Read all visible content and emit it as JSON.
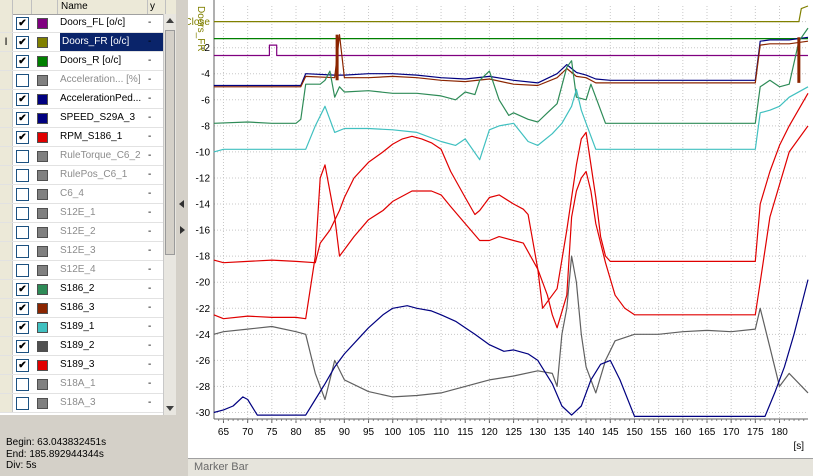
{
  "signal_list": {
    "headers": {
      "name": "Name",
      "y": "y"
    },
    "rows": [
      {
        "checked": true,
        "color": "#800080",
        "name": "Doors_FL [o/c]",
        "y": "-",
        "state": "normal"
      },
      {
        "checked": true,
        "color": "#808000",
        "name": "Doors_FR [o/c]",
        "y": "-",
        "state": "selected"
      },
      {
        "checked": true,
        "color": "#008000",
        "name": "Doors_R [o/c]",
        "y": "-",
        "state": "normal"
      },
      {
        "checked": false,
        "color": "#808080",
        "name": "Acceleration... [%]",
        "y": "-",
        "state": "dim"
      },
      {
        "checked": true,
        "color": "#000080",
        "name": "AccelerationPed...",
        "y": "-",
        "state": "normal"
      },
      {
        "checked": true,
        "color": "#000080",
        "name": "SPEED_S29A_3",
        "y": "-",
        "state": "normal"
      },
      {
        "checked": true,
        "color": "#e00000",
        "name": "RPM_S186_1",
        "y": "-",
        "state": "normal"
      },
      {
        "checked": false,
        "color": "#808080",
        "name": "RuleTorque_C6_2",
        "y": "-",
        "state": "dim"
      },
      {
        "checked": false,
        "color": "#808080",
        "name": "RulePos_C6_1",
        "y": "-",
        "state": "dim"
      },
      {
        "checked": false,
        "color": "#808080",
        "name": "C6_4",
        "y": "-",
        "state": "dim"
      },
      {
        "checked": false,
        "color": "#808080",
        "name": "S12E_1",
        "y": "-",
        "state": "dim"
      },
      {
        "checked": false,
        "color": "#808080",
        "name": "S12E_2",
        "y": "-",
        "state": "dim"
      },
      {
        "checked": false,
        "color": "#808080",
        "name": "S12E_3",
        "y": "-",
        "state": "dim"
      },
      {
        "checked": false,
        "color": "#808080",
        "name": "S12E_4",
        "y": "-",
        "state": "dim"
      },
      {
        "checked": true,
        "color": "#2e8b57",
        "name": "S186_2",
        "y": "-",
        "state": "normal"
      },
      {
        "checked": true,
        "color": "#8b2500",
        "name": "S186_3",
        "y": "-",
        "state": "normal"
      },
      {
        "checked": true,
        "color": "#40c0c0",
        "name": "S189_1",
        "y": "-",
        "state": "normal"
      },
      {
        "checked": true,
        "color": "#505050",
        "name": "S189_2",
        "y": "-",
        "state": "normal"
      },
      {
        "checked": true,
        "color": "#e00000",
        "name": "S189_3",
        "y": "-",
        "state": "normal"
      },
      {
        "checked": false,
        "color": "#808080",
        "name": "S18A_1",
        "y": "-",
        "state": "dim"
      },
      {
        "checked": false,
        "color": "#808080",
        "name": "S18A_3",
        "y": "-",
        "state": "dim"
      }
    ]
  },
  "time_info": {
    "begin": "Begin: 63.043832451s",
    "end": "End: 185.892944344s",
    "div": "Div: 5s"
  },
  "marker_bar": {
    "label": "Marker Bar"
  },
  "chart_data": {
    "type": "line",
    "ylabel": "Doors_FR",
    "xunit": "[s]",
    "xlim": [
      63.04,
      185.89
    ],
    "ylim": [
      -30.5,
      1.2
    ],
    "grid": true,
    "x_ticks": [
      65,
      70,
      75,
      80,
      85,
      90,
      95,
      100,
      105,
      110,
      115,
      120,
      125,
      130,
      135,
      140,
      145,
      150,
      155,
      160,
      165,
      170,
      175,
      180
    ],
    "y_ticks": [
      {
        "v": 0,
        "label": "Close"
      },
      {
        "v": -2,
        "label": "-2"
      },
      {
        "v": -4,
        "label": "-4"
      },
      {
        "v": -6,
        "label": "-6"
      },
      {
        "v": -8,
        "label": "-8"
      },
      {
        "v": -10,
        "label": "-10"
      },
      {
        "v": -12,
        "label": "-12"
      },
      {
        "v": -14,
        "label": "-14"
      },
      {
        "v": -16,
        "label": "-16"
      },
      {
        "v": -18,
        "label": "-18"
      },
      {
        "v": -20,
        "label": "-20"
      },
      {
        "v": -22,
        "label": "-22"
      },
      {
        "v": -24,
        "label": "-24"
      },
      {
        "v": -26,
        "label": "-26"
      },
      {
        "v": -28,
        "label": "-28"
      },
      {
        "v": -30,
        "label": "-30"
      }
    ],
    "series": [
      {
        "color": "#808000",
        "x": [
          63,
          184,
          184.5,
          185.9
        ],
        "y": [
          0,
          0,
          1,
          1.2
        ]
      },
      {
        "color": "#008000",
        "x": [
          63,
          185.9
        ],
        "y": [
          -1.3,
          -1.3
        ]
      },
      {
        "color": "#800080",
        "x": [
          63,
          74.5,
          74.5,
          76,
          76,
          185.9
        ],
        "y": [
          -2.6,
          -2.6,
          -1.8,
          -1.8,
          -2.6,
          -2.6
        ]
      },
      {
        "color": "#000080",
        "x": [
          63,
          81,
          82,
          88,
          90,
          95,
          100,
          105,
          110,
          115,
          120,
          125,
          130,
          134,
          136,
          138,
          140,
          142,
          145,
          150,
          155,
          160,
          165,
          170,
          175,
          176,
          178,
          182,
          185.9
        ],
        "y": [
          -4.9,
          -4.9,
          -4.0,
          -4.1,
          -4.1,
          -4.0,
          -4.0,
          -4.1,
          -4.3,
          -4.4,
          -4.2,
          -4.5,
          -4.7,
          -4.0,
          -3.3,
          -3.9,
          -4.1,
          -4.4,
          -4.5,
          -4.5,
          -4.5,
          -4.5,
          -4.5,
          -4.5,
          -4.5,
          -1.5,
          -1.4,
          -1.4,
          -1.2
        ]
      },
      {
        "color": "#8b2500",
        "x": [
          63,
          81,
          82,
          88,
          89,
          90,
          95,
          100,
          105,
          110,
          115,
          120,
          125,
          130,
          134,
          136,
          138,
          140,
          142,
          145,
          150,
          160,
          170,
          175,
          176,
          178,
          182,
          185.9
        ],
        "y": [
          -5.0,
          -5.0,
          -4.2,
          -4.3,
          -1.0,
          -4.3,
          -4.3,
          -4.2,
          -4.3,
          -4.5,
          -4.6,
          -4.4,
          -4.8,
          -4.9,
          -4.3,
          -3.6,
          -4.2,
          -4.3,
          -4.7,
          -4.7,
          -4.7,
          -4.7,
          -4.7,
          -4.7,
          -1.8,
          -1.7,
          -1.7,
          -1.5
        ]
      },
      {
        "color": "#2e8b57",
        "x": [
          63,
          70,
          75,
          80,
          81,
          82,
          85,
          86,
          87,
          88,
          89,
          90,
          95,
          100,
          105,
          110,
          113,
          115,
          117,
          118,
          120,
          122,
          124,
          125,
          128,
          130,
          132,
          134,
          136,
          137,
          138,
          140,
          141,
          142,
          144,
          145,
          150,
          155,
          160,
          165,
          170,
          175,
          176,
          178,
          180,
          182,
          184,
          185.9
        ],
        "y": [
          -7.8,
          -7.7,
          -7.8,
          -7.8,
          -7.5,
          -4.8,
          -4.8,
          -4.5,
          -3.8,
          -5.8,
          -5.0,
          -5.4,
          -5.3,
          -5.5,
          -5.5,
          -5.7,
          -6.0,
          -5.4,
          -5.6,
          -4.5,
          -3.8,
          -6.0,
          -7.2,
          -7.0,
          -7.5,
          -7.7,
          -7.0,
          -6.3,
          -3.5,
          -3.0,
          -5.8,
          -6.0,
          -4.8,
          -5.8,
          -7.8,
          -7.8,
          -7.8,
          -7.8,
          -7.8,
          -7.8,
          -7.8,
          -7.8,
          -5.0,
          -4.5,
          -5.0,
          -4.8,
          -1.5,
          -0.5
        ]
      },
      {
        "color": "#40c0c0",
        "x": [
          63,
          65,
          70,
          75,
          80,
          82,
          84,
          86,
          88,
          90,
          95,
          100,
          105,
          110,
          113,
          115,
          118,
          120,
          122,
          125,
          128,
          130,
          133,
          135,
          137,
          138,
          139,
          140,
          142,
          145,
          150,
          160,
          170,
          175,
          176,
          178,
          180,
          182,
          185.9
        ],
        "y": [
          -10.0,
          -9.8,
          -9.8,
          -9.8,
          -9.8,
          -9.8,
          -8.0,
          -6.5,
          -8.5,
          -8.2,
          -8.2,
          -8.3,
          -8.5,
          -9.2,
          -9.5,
          -9.0,
          -10.6,
          -8.3,
          -8.0,
          -7.8,
          -9.2,
          -9.5,
          -8.6,
          -7.8,
          -6.5,
          -5.2,
          -6.8,
          -7.8,
          -9.8,
          -9.8,
          -9.8,
          -9.8,
          -9.8,
          -9.8,
          -7.0,
          -6.8,
          -6.5,
          -5.8,
          -5.0
        ]
      },
      {
        "color": "#e00000",
        "x": [
          63,
          65,
          70,
          75,
          80,
          84,
          85,
          87,
          89,
          90,
          92,
          95,
          98,
          100,
          102,
          104,
          106,
          108,
          110,
          112,
          115,
          117,
          118,
          120,
          122,
          125,
          127,
          128,
          130,
          131,
          132,
          134,
          136,
          137,
          138,
          139,
          140,
          142,
          143,
          144,
          145,
          150,
          160,
          170,
          175,
          176,
          178,
          180,
          182,
          185.9
        ],
        "y": [
          -18.3,
          -18.5,
          -18.4,
          -18.3,
          -18.4,
          -18.5,
          -17.0,
          -16.0,
          -14.5,
          -13.5,
          -12.0,
          -10.8,
          -10.0,
          -9.4,
          -9.0,
          -8.8,
          -9.0,
          -9.3,
          -9.8,
          -11.5,
          -13.5,
          -14.8,
          -14.5,
          -13.5,
          -13.3,
          -14.0,
          -14.4,
          -14.8,
          -19.0,
          -22.0,
          -21.5,
          -20.5,
          -16.0,
          -13.5,
          -11.0,
          -9.0,
          -8.5,
          -13.5,
          -16.5,
          -18.0,
          -18.4,
          -18.4,
          -18.4,
          -18.4,
          -18.4,
          -14.0,
          -11.5,
          -9.5,
          -8.0,
          -5.5
        ]
      },
      {
        "color": "#e00000",
        "x": [
          63,
          65,
          70,
          75,
          80,
          82,
          84,
          85,
          86,
          88,
          89,
          90,
          92,
          95,
          98,
          100,
          104,
          108,
          110,
          112,
          115,
          118,
          120,
          122,
          125,
          127,
          130,
          132,
          133,
          134,
          136,
          137,
          138,
          139,
          140,
          141,
          142,
          144,
          146,
          148,
          150,
          160,
          170,
          175,
          176,
          178,
          182,
          185.9
        ],
        "y": [
          -22.5,
          -22.8,
          -22.6,
          -22.7,
          -22.7,
          -22.8,
          -18.0,
          -12.0,
          -11.0,
          -15.0,
          -18.0,
          -17.5,
          -16.5,
          -15.2,
          -14.5,
          -13.8,
          -13.0,
          -13.0,
          -13.3,
          -14.2,
          -15.5,
          -16.8,
          -16.8,
          -16.5,
          -16.8,
          -17.0,
          -19.0,
          -21.0,
          -22.5,
          -23.5,
          -21.0,
          -15.0,
          -13.0,
          -12.0,
          -11.5,
          -13.0,
          -15.5,
          -18.5,
          -21.0,
          -22.0,
          -22.5,
          -22.5,
          -22.5,
          -22.5,
          -20.0,
          -15.0,
          -10.0,
          -8.0
        ]
      },
      {
        "color": "#606060",
        "x": [
          63,
          65,
          70,
          75,
          80,
          82,
          84,
          86,
          87,
          88,
          90,
          95,
          100,
          105,
          110,
          115,
          120,
          125,
          130,
          133,
          134,
          135,
          136,
          137,
          138,
          139,
          140,
          142,
          144,
          146,
          150,
          155,
          160,
          165,
          170,
          175,
          176,
          178,
          180,
          182,
          185.9
        ],
        "y": [
          -24.0,
          -23.8,
          -23.6,
          -23.4,
          -23.8,
          -24.0,
          -27.0,
          -29.0,
          -27.5,
          -26.0,
          -27.5,
          -28.4,
          -28.8,
          -28.7,
          -28.5,
          -28.0,
          -27.5,
          -27.2,
          -26.8,
          -27.0,
          -28.0,
          -24.0,
          -22.0,
          -18.0,
          -20.0,
          -24.0,
          -26.5,
          -28.5,
          -26.0,
          -24.5,
          -24.0,
          -24.0,
          -23.8,
          -23.7,
          -23.8,
          -23.6,
          -22.0,
          -25.0,
          -28.0,
          -27.0,
          -28.5
        ]
      },
      {
        "color": "#000080",
        "x": [
          63,
          65,
          67,
          69,
          70,
          72,
          75,
          80,
          82,
          84,
          86,
          88,
          90,
          93,
          95,
          98,
          100,
          103,
          105,
          108,
          110,
          113,
          115,
          117,
          120,
          123,
          125,
          128,
          130,
          133,
          135,
          137,
          139,
          141,
          143,
          145,
          147,
          150,
          155,
          160,
          165,
          170,
          175,
          177,
          179,
          181,
          183,
          185.9
        ],
        "y": [
          -30.0,
          -29.8,
          -29.5,
          -28.8,
          -29.0,
          -30.2,
          -30.2,
          -30.2,
          -30.2,
          -29.0,
          -27.8,
          -26.5,
          -25.5,
          -24.3,
          -23.5,
          -22.5,
          -22.0,
          -21.8,
          -22.0,
          -22.2,
          -22.5,
          -23.0,
          -23.5,
          -24.0,
          -24.8,
          -25.3,
          -25.2,
          -25.5,
          -26.0,
          -27.8,
          -29.5,
          -30.2,
          -29.5,
          -27.5,
          -26.3,
          -26.0,
          -27.5,
          -30.3,
          -30.3,
          -30.3,
          -30.3,
          -30.3,
          -30.3,
          -30.3,
          -28.5,
          -26.5,
          -24.0,
          -19.8
        ]
      }
    ],
    "markers": [
      {
        "x": 88.5,
        "y": -1.0,
        "color": "#8b2500",
        "h": 3.5
      },
      {
        "x": 184.0,
        "y": -1.2,
        "color": "#8b2500",
        "h": 3.5
      }
    ]
  }
}
